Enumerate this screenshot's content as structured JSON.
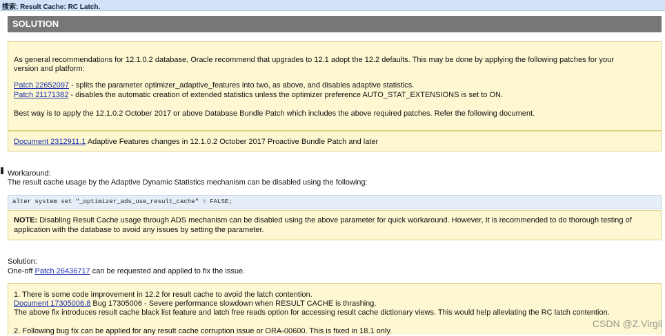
{
  "search_bar": {
    "text": "搜索: Result Cache: RC Latch."
  },
  "solution_banner": {
    "title": "SOLUTION"
  },
  "recommendation_box": {
    "para1_line1": "As general recommendations for 12.1.0.2 database, Oracle recommend that upgrades to 12.1 adopt the 12.2 defaults. This may be done by applying the following patches for your",
    "para1_line2": "version and platform:",
    "patch1_link": "Patch 22652097",
    "patch1_text": " - splits the parameter optimizer_adaptive_features into two, as above, and disables adaptive statistics.",
    "patch2_link": "Patch 21171382",
    "patch2_text": " - disables the automatic creation of extended statistics unless the optimizer preference AUTO_STAT_EXTENSIONS is set to ON.",
    "best_way": "Best way is to apply the 12.1.0.2 October 2017 or above Database Bundle Patch which includes the above required patches. Refer the following document."
  },
  "document_box": {
    "doc_link": "Document 2312911.1",
    "doc_text": " Adaptive Features changes in 12.1.0.2 October 2017 Proactive Bundle Patch and later"
  },
  "workaround": {
    "heading": "Workaround:",
    "text": "The result cache usage by the Adaptive Dynamic Statistics mechanism can be disabled using the following:"
  },
  "code": {
    "text": "alter system set \"_optimizer_ads_use_result_cache\" = FALSE;"
  },
  "note_box": {
    "label": "NOTE:",
    "line1": " Disabling Result Cache usage through ADS mechanism can be disabled using the above parameter for quick workaround. However, It is recommended to do thorough testing of",
    "line2": "application with the database to avoid any issues by setting the parameter."
  },
  "solution_section": {
    "heading": "Solution:",
    "prefix": "One-off ",
    "patch_link": "Patch 26436717",
    "suffix": " can be requested and applied to fix the issue."
  },
  "improvement_box": {
    "line1": "1. There is some code improvement in 12.2 for result cache to avoid the latch contention.",
    "doc_link": "Document 17305006.8",
    "doc_text": " Bug 17305006 - Severe performance slowdown when RESULT CACHE is thrashing.",
    "line3": "The above fix introduces result cache black list feature and latch free reads option for accessing result cache dictionary views. This would help alleviating the RC latch contention.",
    "line4": "2. Following bug fix can be applied for any result cache corruption issue or ORA-00600. This is fixed in 18.1 only."
  },
  "watermark": {
    "text": "CSDN @Z.Virgil"
  }
}
